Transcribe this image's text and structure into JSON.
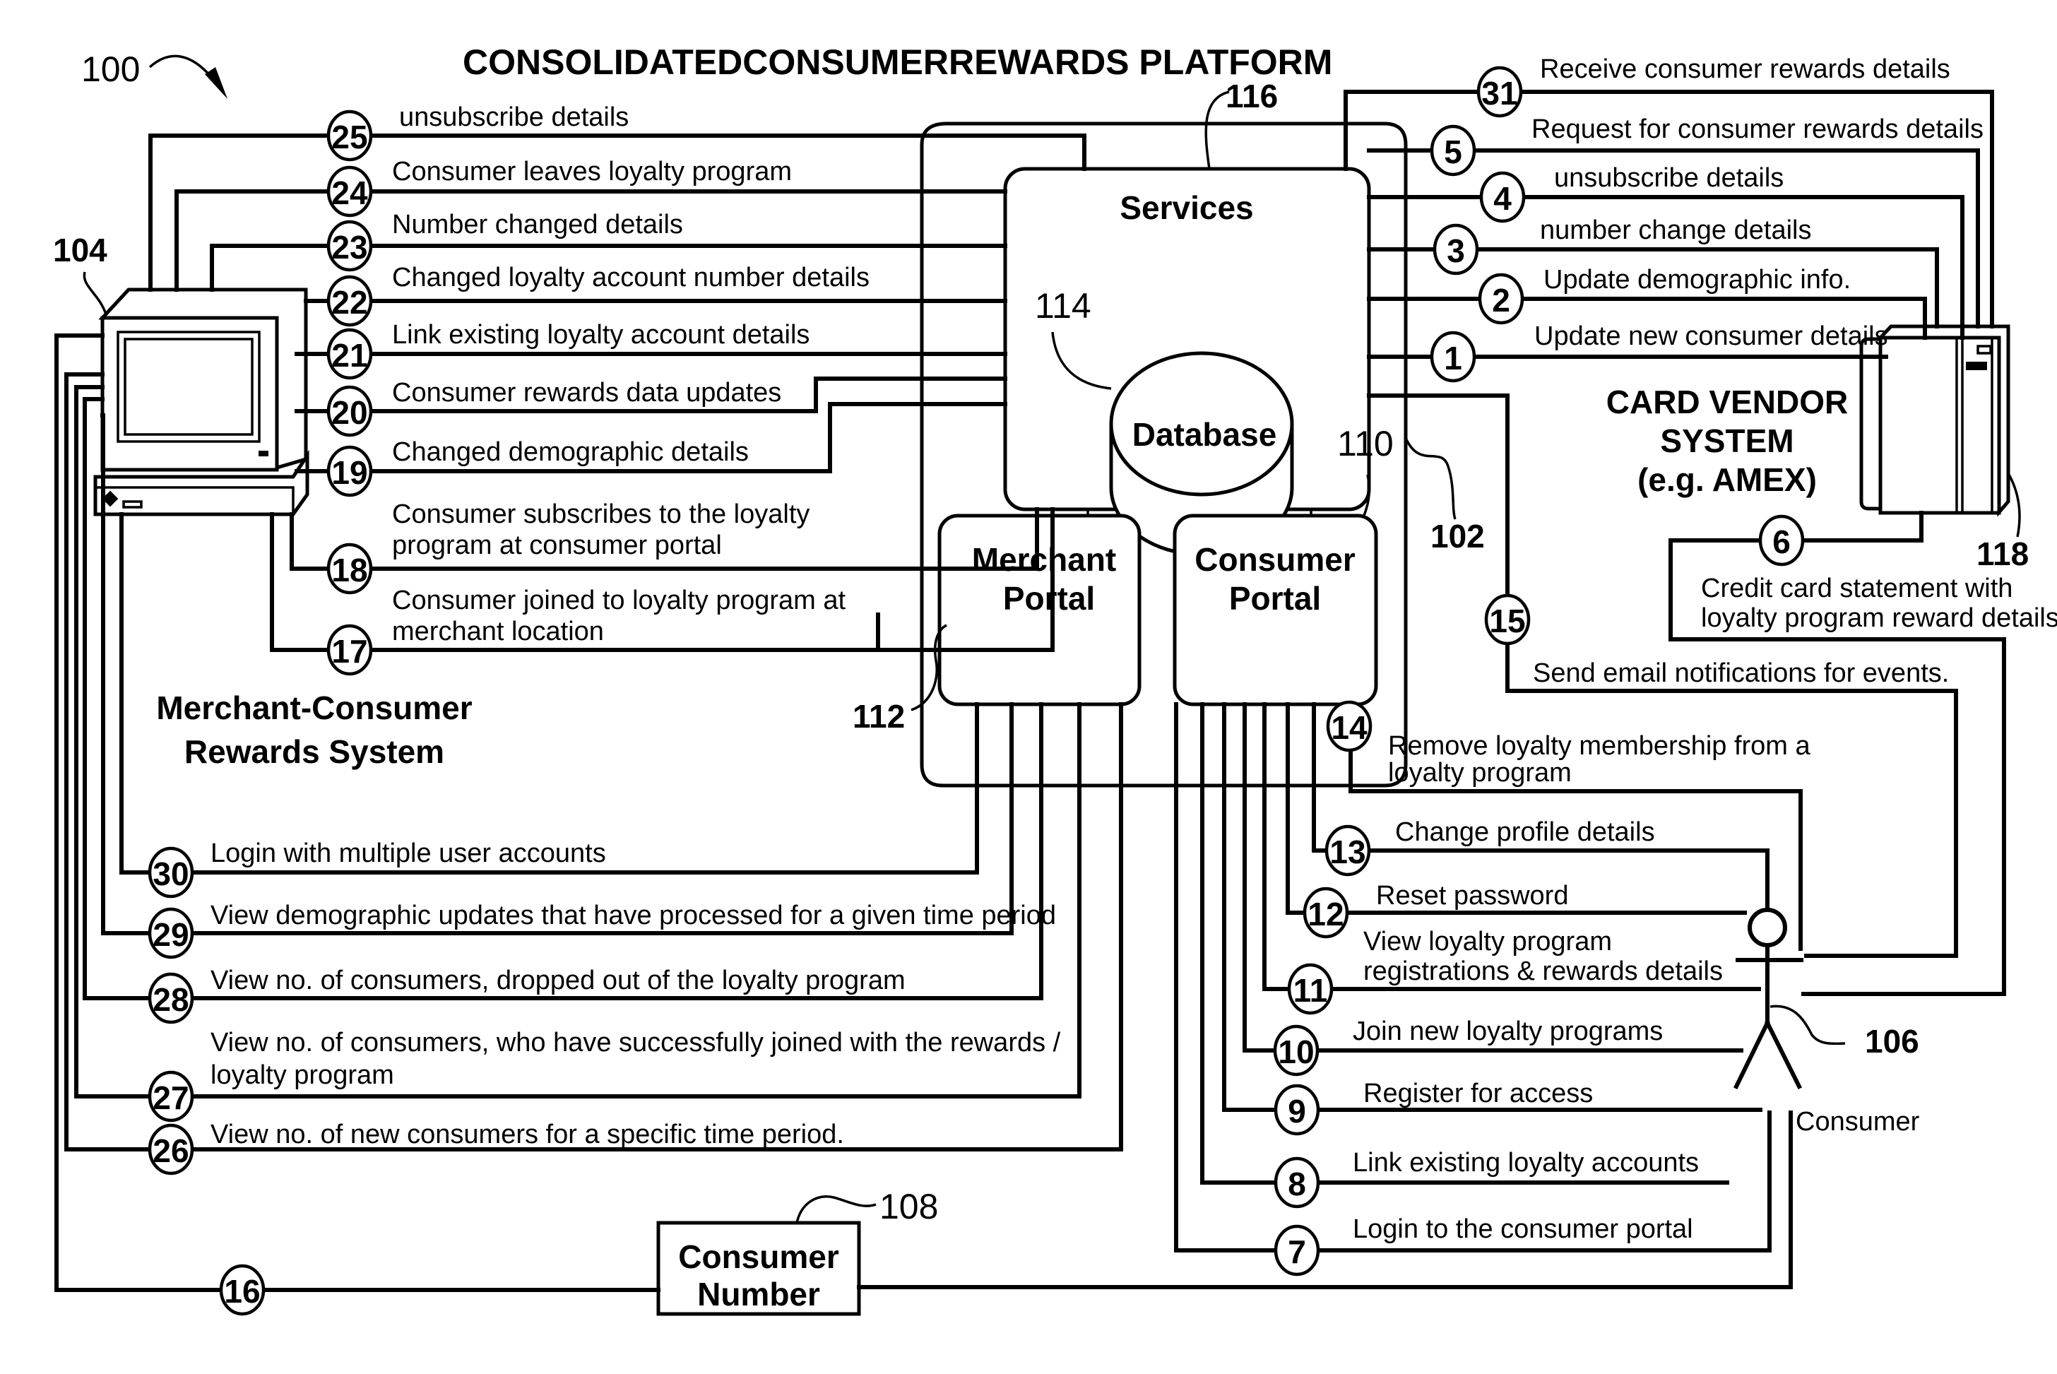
{
  "title": "CONSOLIDATEDCONSUMERREWARDS PLATFORM",
  "reference_labels": {
    "figure": "100",
    "platform": "102",
    "merchant_system": "104",
    "consumer": "106",
    "consumer_number": "108",
    "consumer_portal": "110",
    "merchant_portal": "112",
    "database": "114",
    "services": "116",
    "card_vendor": "118"
  },
  "blocks": {
    "services": "Services",
    "database": "Database",
    "merchant_portal": [
      "Merchant",
      "Portal"
    ],
    "consumer_portal": [
      "Consumer",
      "Portal"
    ],
    "consumer_number": [
      "Consumer",
      "Number"
    ],
    "card_vendor": [
      "CARD VENDOR",
      "SYSTEM",
      "(e.g. AMEX)"
    ],
    "merchant_system": [
      "Merchant-Consumer",
      "Rewards  System"
    ],
    "consumer_actor": "Consumer"
  },
  "flows": [
    {
      "n": "1",
      "text": [
        "Update new consumer details"
      ]
    },
    {
      "n": "2",
      "text": [
        "Update demographic info."
      ]
    },
    {
      "n": "3",
      "text": [
        "number change details"
      ]
    },
    {
      "n": "4",
      "text": [
        "unsubscribe details"
      ]
    },
    {
      "n": "5",
      "text": [
        "Request for consumer rewards details"
      ]
    },
    {
      "n": "6",
      "text": [
        "Credit card statement with",
        "loyalty program reward details"
      ]
    },
    {
      "n": "7",
      "text": [
        "Login to the consumer portal"
      ]
    },
    {
      "n": "8",
      "text": [
        "Link existing loyalty accounts"
      ]
    },
    {
      "n": "9",
      "text": [
        "Register for access"
      ]
    },
    {
      "n": "10",
      "text": [
        "Join new loyalty programs"
      ]
    },
    {
      "n": "11",
      "text": [
        "View loyalty program",
        "registrations & rewards details"
      ]
    },
    {
      "n": "12",
      "text": [
        "Reset password"
      ]
    },
    {
      "n": "13",
      "text": [
        "Change profile details"
      ]
    },
    {
      "n": "14",
      "text": [
        "Remove loyalty membership from a",
        "loyalty program"
      ]
    },
    {
      "n": "15",
      "text": [
        "Send email notifications for events."
      ]
    },
    {
      "n": "16",
      "text": []
    },
    {
      "n": "17",
      "text": [
        "Consumer joined to loyalty program at",
        "merchant location"
      ]
    },
    {
      "n": "18",
      "text": [
        "Consumer subscribes to the loyalty",
        "program at consumer portal"
      ]
    },
    {
      "n": "19",
      "text": [
        "Changed demographic details"
      ]
    },
    {
      "n": "20",
      "text": [
        "Consumer  rewards data updates"
      ]
    },
    {
      "n": "21",
      "text": [
        "Link existing loyalty account details"
      ]
    },
    {
      "n": "22",
      "text": [
        "Changed loyalty account number details"
      ]
    },
    {
      "n": "23",
      "text": [
        "Number changed details"
      ]
    },
    {
      "n": "24",
      "text": [
        "Consumer leaves loyalty program"
      ]
    },
    {
      "n": "25",
      "text": [
        "unsubscribe details"
      ]
    },
    {
      "n": "26",
      "text": [
        "View no. of new consumers for a specific time period."
      ]
    },
    {
      "n": "27",
      "text": [
        "View no. of consumers, who have successfully joined  with the rewards /",
        "loyalty program"
      ]
    },
    {
      "n": "28",
      "text": [
        "View no. of consumers, dropped out of the loyalty program"
      ]
    },
    {
      "n": "29",
      "text": [
        "View demographic updates that have processed for a given time period"
      ]
    },
    {
      "n": "30",
      "text": [
        "Login with multiple user accounts"
      ]
    },
    {
      "n": "31",
      "text": [
        "Receive consumer rewards details"
      ]
    }
  ]
}
